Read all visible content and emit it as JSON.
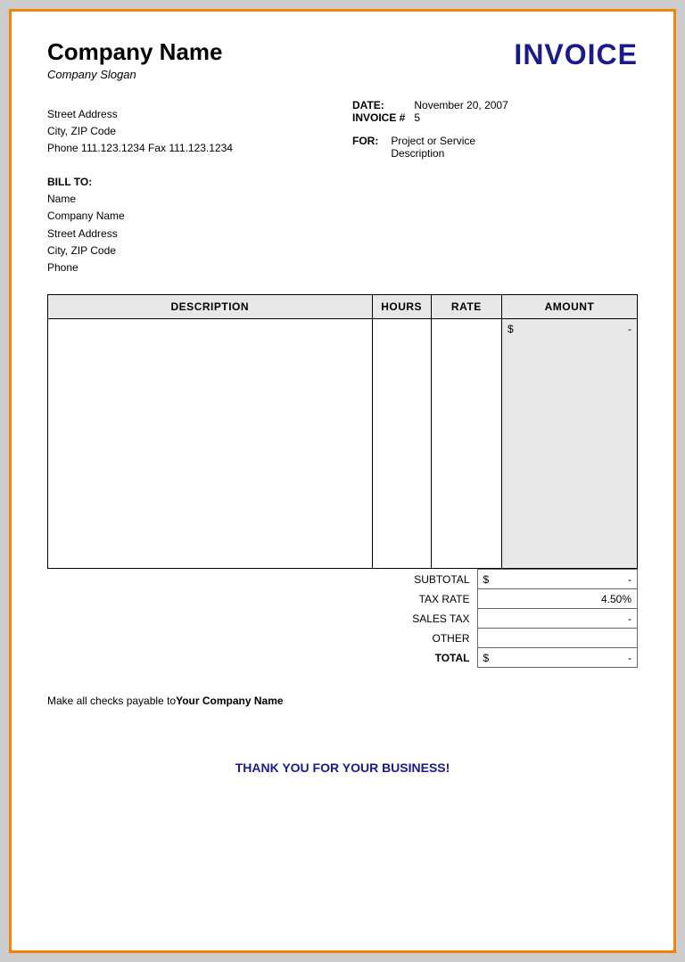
{
  "company": {
    "name": "Company Name",
    "slogan": "Company Slogan",
    "address_line1": "Street Address",
    "address_line2": "City, ZIP Code",
    "address_line3": "Phone 111.123.1234   Fax 111.123.1234"
  },
  "invoice": {
    "title": "INVOICE",
    "date_label": "DATE:",
    "date_value": "November 20, 2007",
    "invoice_num_label": "INVOICE #",
    "invoice_num_value": "5",
    "for_label": "FOR:",
    "for_description_line1": "Project or Service",
    "for_description_line2": "Description"
  },
  "bill_to": {
    "label": "BILL TO:",
    "name": "Name",
    "company": "Company Name",
    "address": "Street Address",
    "city": "City, ZIP Code",
    "phone": "Phone"
  },
  "table": {
    "headers": {
      "description": "DESCRIPTION",
      "hours": "HOURS",
      "rate": "RATE",
      "amount": "AMOUNT"
    },
    "amount_dollar": "$",
    "amount_dash": "-"
  },
  "summary": {
    "subtotal_label": "SUBTOTAL",
    "subtotal_dollar": "$",
    "subtotal_value": "-",
    "tax_rate_label": "TAX RATE",
    "tax_rate_value": "4.50%",
    "sales_tax_label": "SALES TAX",
    "sales_tax_value": "-",
    "other_label": "OTHER",
    "other_value": "",
    "total_label": "TOTAL",
    "total_dollar": "$",
    "total_value": "-"
  },
  "footer": {
    "note_prefix": "Make all checks payable to",
    "note_bold": "Your Company Name",
    "thank_you": "THANK YOU FOR YOUR BUSINESS!"
  }
}
